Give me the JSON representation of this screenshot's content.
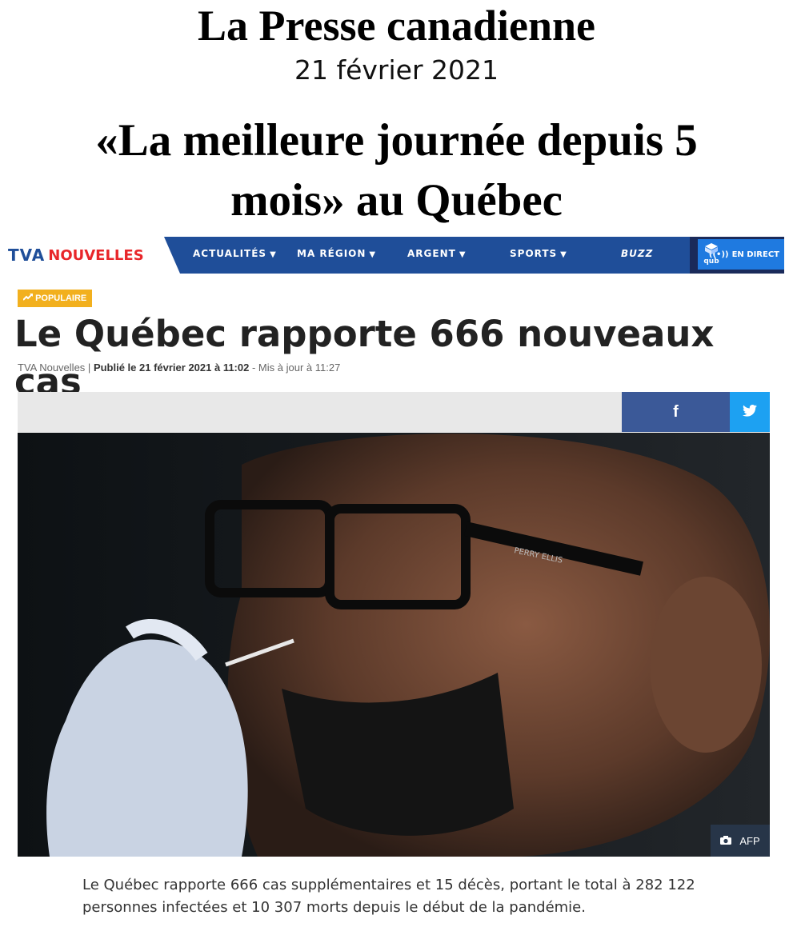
{
  "overlay": {
    "source": "La Presse canadienne",
    "date": "21 février 2021",
    "headline": "«La meilleure journée depuis 5 mois» au Québec"
  },
  "nav": {
    "logo_tva": "TVA",
    "logo_news": "NOUVELLES",
    "items": [
      {
        "label": "ACTUALITÉS",
        "caret": "▼"
      },
      {
        "label": "MA RÉGION",
        "caret": "▼"
      },
      {
        "label": "ARGENT",
        "caret": "▼"
      },
      {
        "label": "SPORTS",
        "caret": "▼"
      },
      {
        "label": "BUZZ"
      }
    ],
    "live_label": "EN DIRECT",
    "qub_label": "qub"
  },
  "article": {
    "badge": "POPULAIRE",
    "title": "Le Québec rapporte 666 nouveaux cas",
    "byline_source": "TVA Nouvelles",
    "byline_published": "Publié le 21 février 2021 à 11:02",
    "byline_updated": "- Mis à jour à 11:27",
    "share_facebook": "f",
    "share_twitter": "🐦",
    "photo_credit": "AFP",
    "photo_label": "PERRY ELLIS",
    "lede": "Le Québec rapporte 666 cas supplémentaires et 15 décès, portant le total à 282 122 personnes infectées et 10 307 morts depuis le début de la pandémie."
  },
  "colors": {
    "nav_blue": "#1f4e99",
    "badge_yellow": "#f2b01e",
    "facebook": "#3b5998",
    "twitter": "#1da1f2",
    "logo_red": "#e8262a"
  }
}
